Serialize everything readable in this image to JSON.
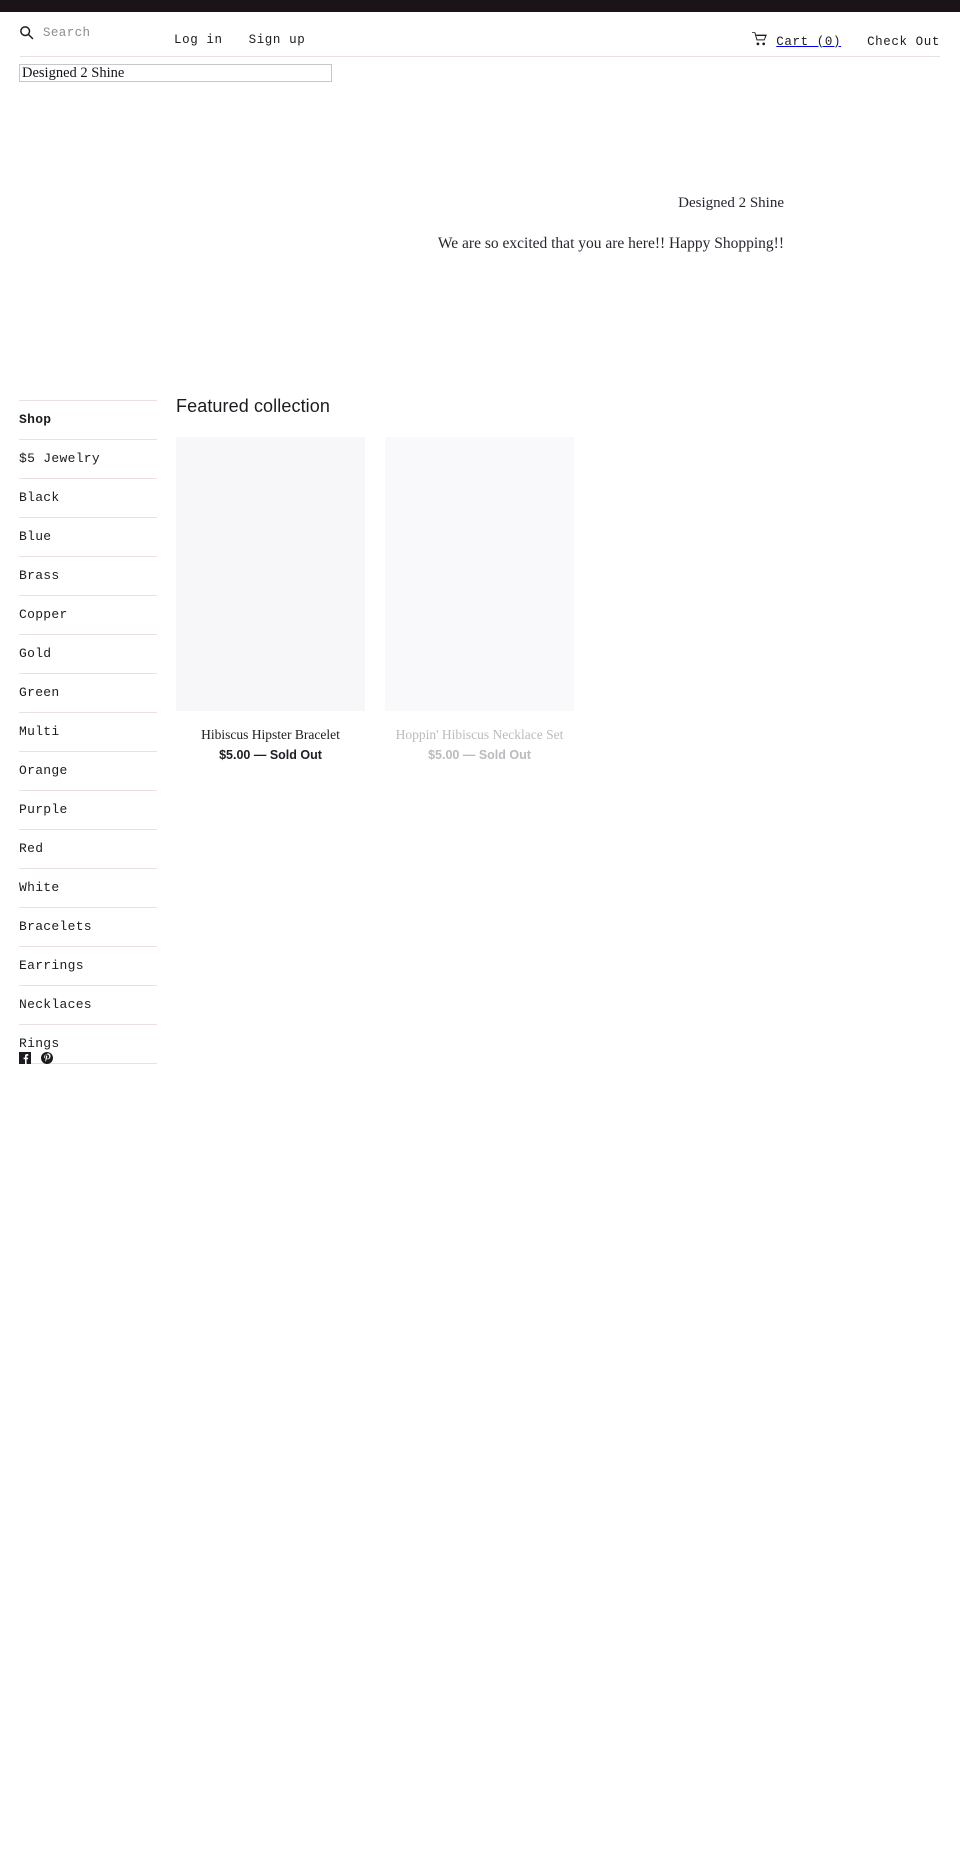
{
  "header": {
    "search": {
      "icon": "search-icon",
      "placeholder": "Search",
      "value": ""
    },
    "auth": [
      {
        "label": "Log in"
      },
      {
        "label": "Sign up"
      }
    ],
    "cart": {
      "icon": "shopping-cart-icon",
      "label": "Cart (0)"
    },
    "checkout": {
      "label": "Check Out"
    }
  },
  "logo": {
    "alt_text": "Designed 2 Shine"
  },
  "hero": {
    "title": "Designed 2 Shine",
    "subtitle": "We are so excited that you are here!! Happy Shopping!!"
  },
  "sidebar": {
    "items": [
      {
        "label": "Shop",
        "active": true
      },
      {
        "label": "$5 Jewelry",
        "active": false
      },
      {
        "label": "Black",
        "active": false
      },
      {
        "label": "Blue",
        "active": false
      },
      {
        "label": "Brass",
        "active": false
      },
      {
        "label": "Copper",
        "active": false
      },
      {
        "label": "Gold",
        "active": false
      },
      {
        "label": "Green",
        "active": false
      },
      {
        "label": "Multi",
        "active": false
      },
      {
        "label": "Orange",
        "active": false
      },
      {
        "label": "Purple",
        "active": false
      },
      {
        "label": "Red",
        "active": false
      },
      {
        "label": "White",
        "active": false
      },
      {
        "label": "Bracelets",
        "active": false
      },
      {
        "label": "Earrings",
        "active": false
      },
      {
        "label": "Necklaces",
        "active": false
      },
      {
        "label": "Rings",
        "active": false
      }
    ],
    "social": [
      {
        "icon": "facebook-icon",
        "name": "Facebook"
      },
      {
        "icon": "pinterest-icon",
        "name": "Pinterest"
      }
    ]
  },
  "main": {
    "section_title": "Featured collection",
    "products": [
      {
        "title": "Hibiscus Hipster Bracelet",
        "price_line": "$5.00 — Sold Out",
        "faded": false
      },
      {
        "title": "Hoppin' Hibiscus Necklace Set",
        "price_line": "$5.00 — Sold Out",
        "faded": true
      }
    ]
  },
  "colors": {
    "topbar": "#1a1418",
    "rule": "#eadfe4",
    "text": "#1c1b1f",
    "muted": "#bcbabf",
    "placeholder": "#8f8b90",
    "tile": "#f7f6f8"
  }
}
